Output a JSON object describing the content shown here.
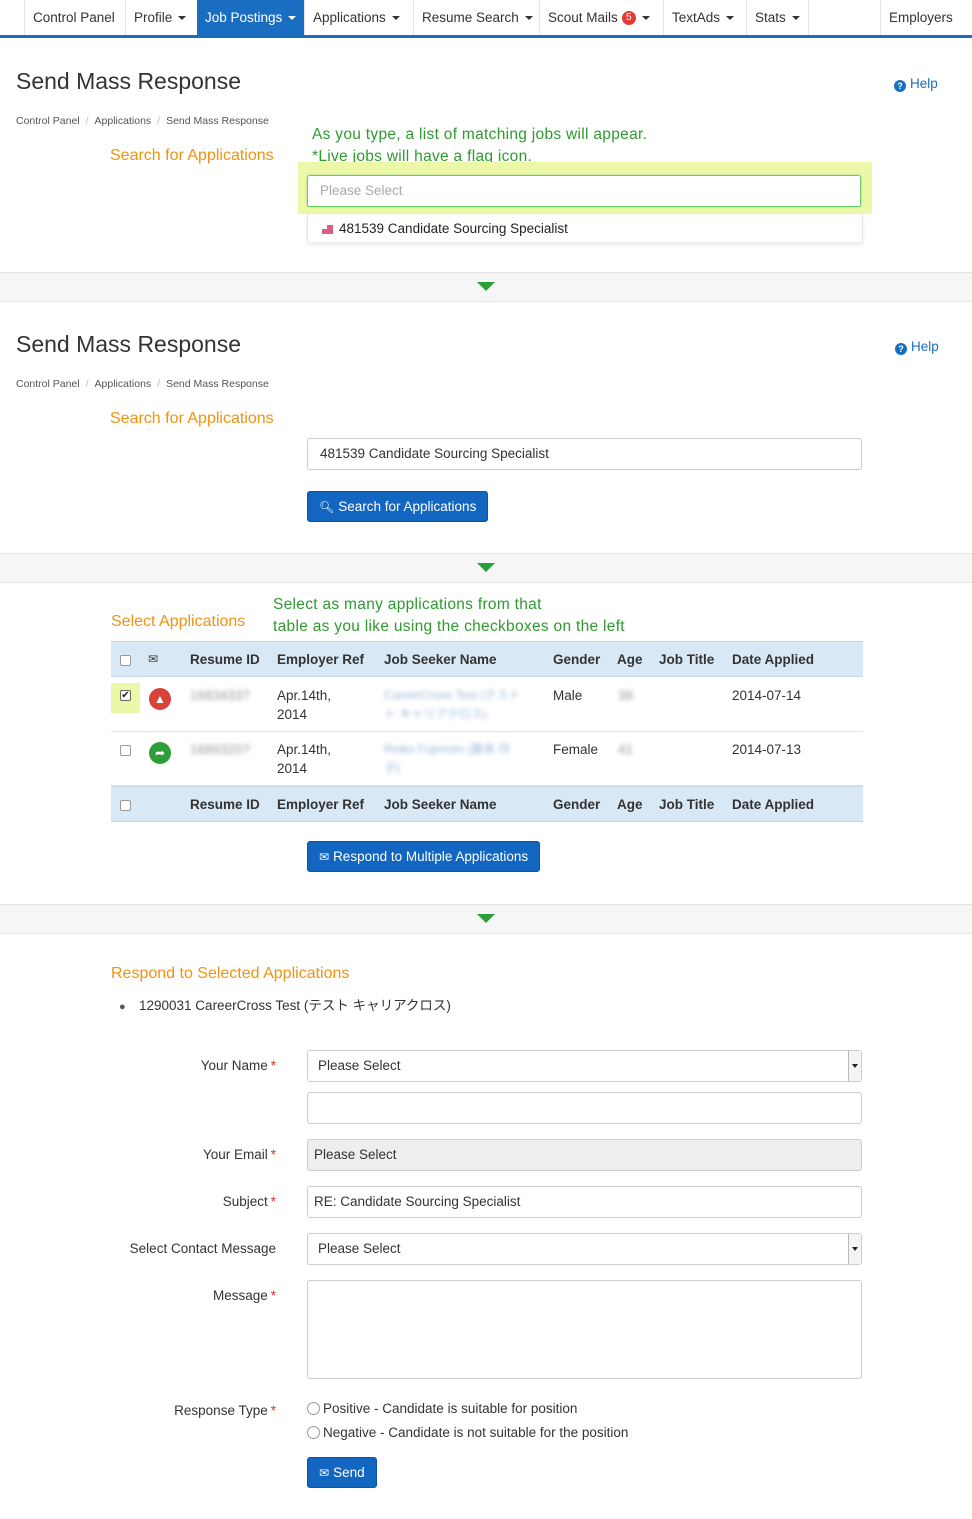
{
  "nav": {
    "items": [
      "Control Panel",
      "Profile",
      "Job Postings",
      "Applications",
      "Resume Search",
      "Scout Mails",
      "TextAds",
      "Stats",
      "Employers"
    ],
    "scout_mails_badge": "5",
    "active": "Job Postings"
  },
  "panel1": {
    "title": "Send Mass Response",
    "help": "Help",
    "breadcrumb": [
      "Control Panel",
      "Applications",
      "Send Mass Response"
    ],
    "search_label": "Search for Applications",
    "note_line1": "As you type, a list of matching jobs will appear.",
    "note_line2": "*Live jobs will have a flag icon.",
    "placeholder": "Please Select",
    "dropdown_option": "481539 Candidate Sourcing Specialist"
  },
  "panel2": {
    "title": "Send Mass Response",
    "help": "Help",
    "breadcrumb": [
      "Control Panel",
      "Applications",
      "Send Mass Response"
    ],
    "search_label": "Search for Applications",
    "search_value": "481539 Candidate Sourcing Specialist",
    "search_button": "Search for Applications"
  },
  "panel3": {
    "label": "Select Applications",
    "note_line1": "Select as many applications from that",
    "note_line2": "table as you like using the checkboxes on the left",
    "columns": [
      "Resume ID",
      "Employer Ref",
      "Job Seeker Name",
      "Gender",
      "Age",
      "Job Title",
      "Date Applied"
    ],
    "rows": [
      {
        "resume_id": "1683433?",
        "employer_ref_1": "Apr.14th,",
        "employer_ref_2": "2014",
        "name_1": "CareerCross Test (テスト",
        "name_2": "ト キャリアクロス)",
        "gender": "Male",
        "age": "38",
        "job_title": "",
        "date": "2014-07-14",
        "checked": true
      },
      {
        "resume_id": "1689320?",
        "employer_ref_1": "Apr.14th,",
        "employer_ref_2": "2014",
        "name_1": "Reiko Fujimoto (藤本 玲",
        "name_2": "子)",
        "gender": "Female",
        "age": "41",
        "job_title": "",
        "date": "2014-07-13",
        "checked": false
      }
    ],
    "respond_button": "Respond to Multiple Applications"
  },
  "panel4": {
    "label": "Respond to Selected Applications",
    "recipient": "1290031 CareerCross Test (テスト キャリアクロス)",
    "your_name_label": "Your Name",
    "your_name_value": "Please Select",
    "your_name_extra": "",
    "your_email_label": "Your Email",
    "your_email_value": "Please Select",
    "subject_label": "Subject",
    "subject_value": "RE: Candidate Sourcing Specialist",
    "contact_label": "Select Contact Message",
    "contact_value": "Please Select",
    "message_label": "Message",
    "message_value": "",
    "response_type_label": "Response Type",
    "response_positive": "Positive - Candidate is suitable for position",
    "response_negative": "Negative - Candidate is not suitable for the position",
    "send_button": "Send",
    "required_mark": "*"
  },
  "colors": {
    "primary": "#1266c0",
    "accent_orange": "#f0930e",
    "note_green": "#2e9a2e",
    "highlight": "#ecf7a8",
    "table_header": "#d9e8f5",
    "badge": "#e53935"
  }
}
